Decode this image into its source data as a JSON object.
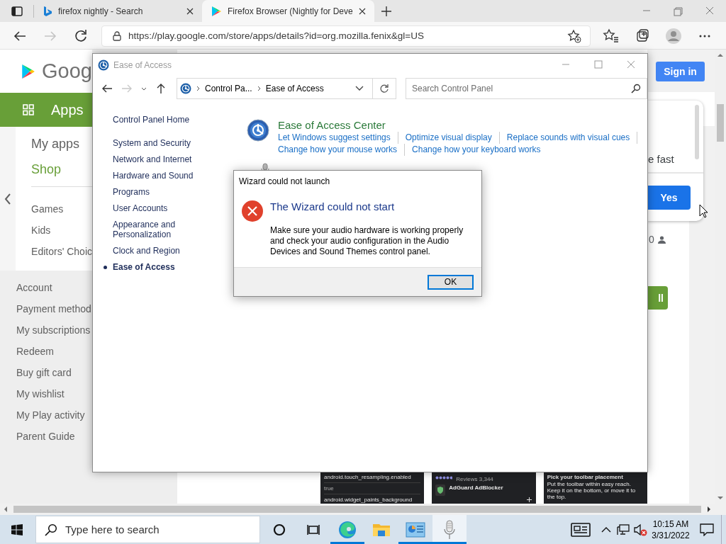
{
  "browser": {
    "tabs": [
      {
        "label": "firefox nightly - Search",
        "kind": "search",
        "selected": false
      },
      {
        "label": "Firefox Browser (Nightly for Deve",
        "kind": "store",
        "selected": true
      }
    ],
    "nav": [
      {
        "kind": "back",
        "disabled": false
      },
      {
        "kind": "forward",
        "disabled": true
      },
      {
        "kind": "reload",
        "disabled": false
      }
    ],
    "address": "https://play.google.com/store/apps/details?id=org.mozilla.fenix&gl=US"
  },
  "play": {
    "logo_text": "Goog",
    "apps_tab": "Apps",
    "menu": [
      {
        "label": "My apps",
        "selected": false
      },
      {
        "label": "Shop",
        "selected": true
      }
    ],
    "categories": [
      "Games",
      "Kids",
      "Editors' Choic"
    ],
    "account_links": [
      "Account",
      "Payment method",
      "My subscriptions",
      "Redeem",
      "Buy gift card",
      "My wishlist",
      "My Play activity",
      "Parent Guide"
    ],
    "sign_in": "Sign in",
    "popup": {
      "text": "e fast",
      "button": "Yes"
    },
    "rating_count": "0",
    "install_button": "ll",
    "screenshots": [
      {
        "kind": "settings",
        "lines": [
          "android.touch_resampling.enabled",
          "true",
          "android.widget_paints_background"
        ]
      },
      {
        "kind": "listing",
        "lines": [
          "Reviews 3,344",
          "AdGuard AdBlocker"
        ]
      },
      {
        "kind": "toolbar",
        "lines": [
          "Pick your toolbar placement",
          "Put the toolbar within easy reach. Keep it on the bottom, or move it to the top."
        ]
      }
    ]
  },
  "control_panel": {
    "title": "Ease of Access",
    "breadcrumb": [
      "Control Pa...",
      "Ease of Access"
    ],
    "search": {
      "placeholder": "Search Control Panel"
    },
    "home_link": "Control Panel Home",
    "categories": [
      {
        "label": "System and Security",
        "selected": false
      },
      {
        "label": "Network and Internet",
        "selected": false
      },
      {
        "label": "Hardware and Sound",
        "selected": false
      },
      {
        "label": "Programs",
        "selected": false
      },
      {
        "label": "User Accounts",
        "selected": false
      },
      {
        "label": "Appearance and Personalization",
        "selected": false
      },
      {
        "label": "Clock and Region",
        "selected": false
      },
      {
        "label": "Ease of Access",
        "selected": true
      }
    ],
    "sections": [
      {
        "kind": "center",
        "title": "Ease of Access Center",
        "link_rows": [
          [
            "Let Windows suggest settings",
            "Optimize visual display",
            "Replace sounds with visual cues"
          ],
          [
            "Change how your mouse works",
            "Change how your keyboard works"
          ]
        ]
      },
      {
        "kind": "speech"
      }
    ]
  },
  "dialog": {
    "title": "Wizard could not launch",
    "heading": "The Wizard could not start",
    "message": "Make sure your audio hardware is working properly and check your audio configuration in the Audio Devices and Sound Themes control panel.",
    "button": "OK"
  },
  "taskbar": {
    "search": {
      "placeholder": "Type here to search"
    },
    "apps": [
      {
        "kind": "edge",
        "running": true,
        "selected": false
      },
      {
        "kind": "explorer",
        "running": false,
        "selected": false
      },
      {
        "kind": "control-panel",
        "running": true,
        "selected": false
      },
      {
        "kind": "microphone",
        "running": true,
        "selected": true
      }
    ],
    "volume_muted": true,
    "time": "10:15 AM",
    "date": "3/31/2022"
  }
}
